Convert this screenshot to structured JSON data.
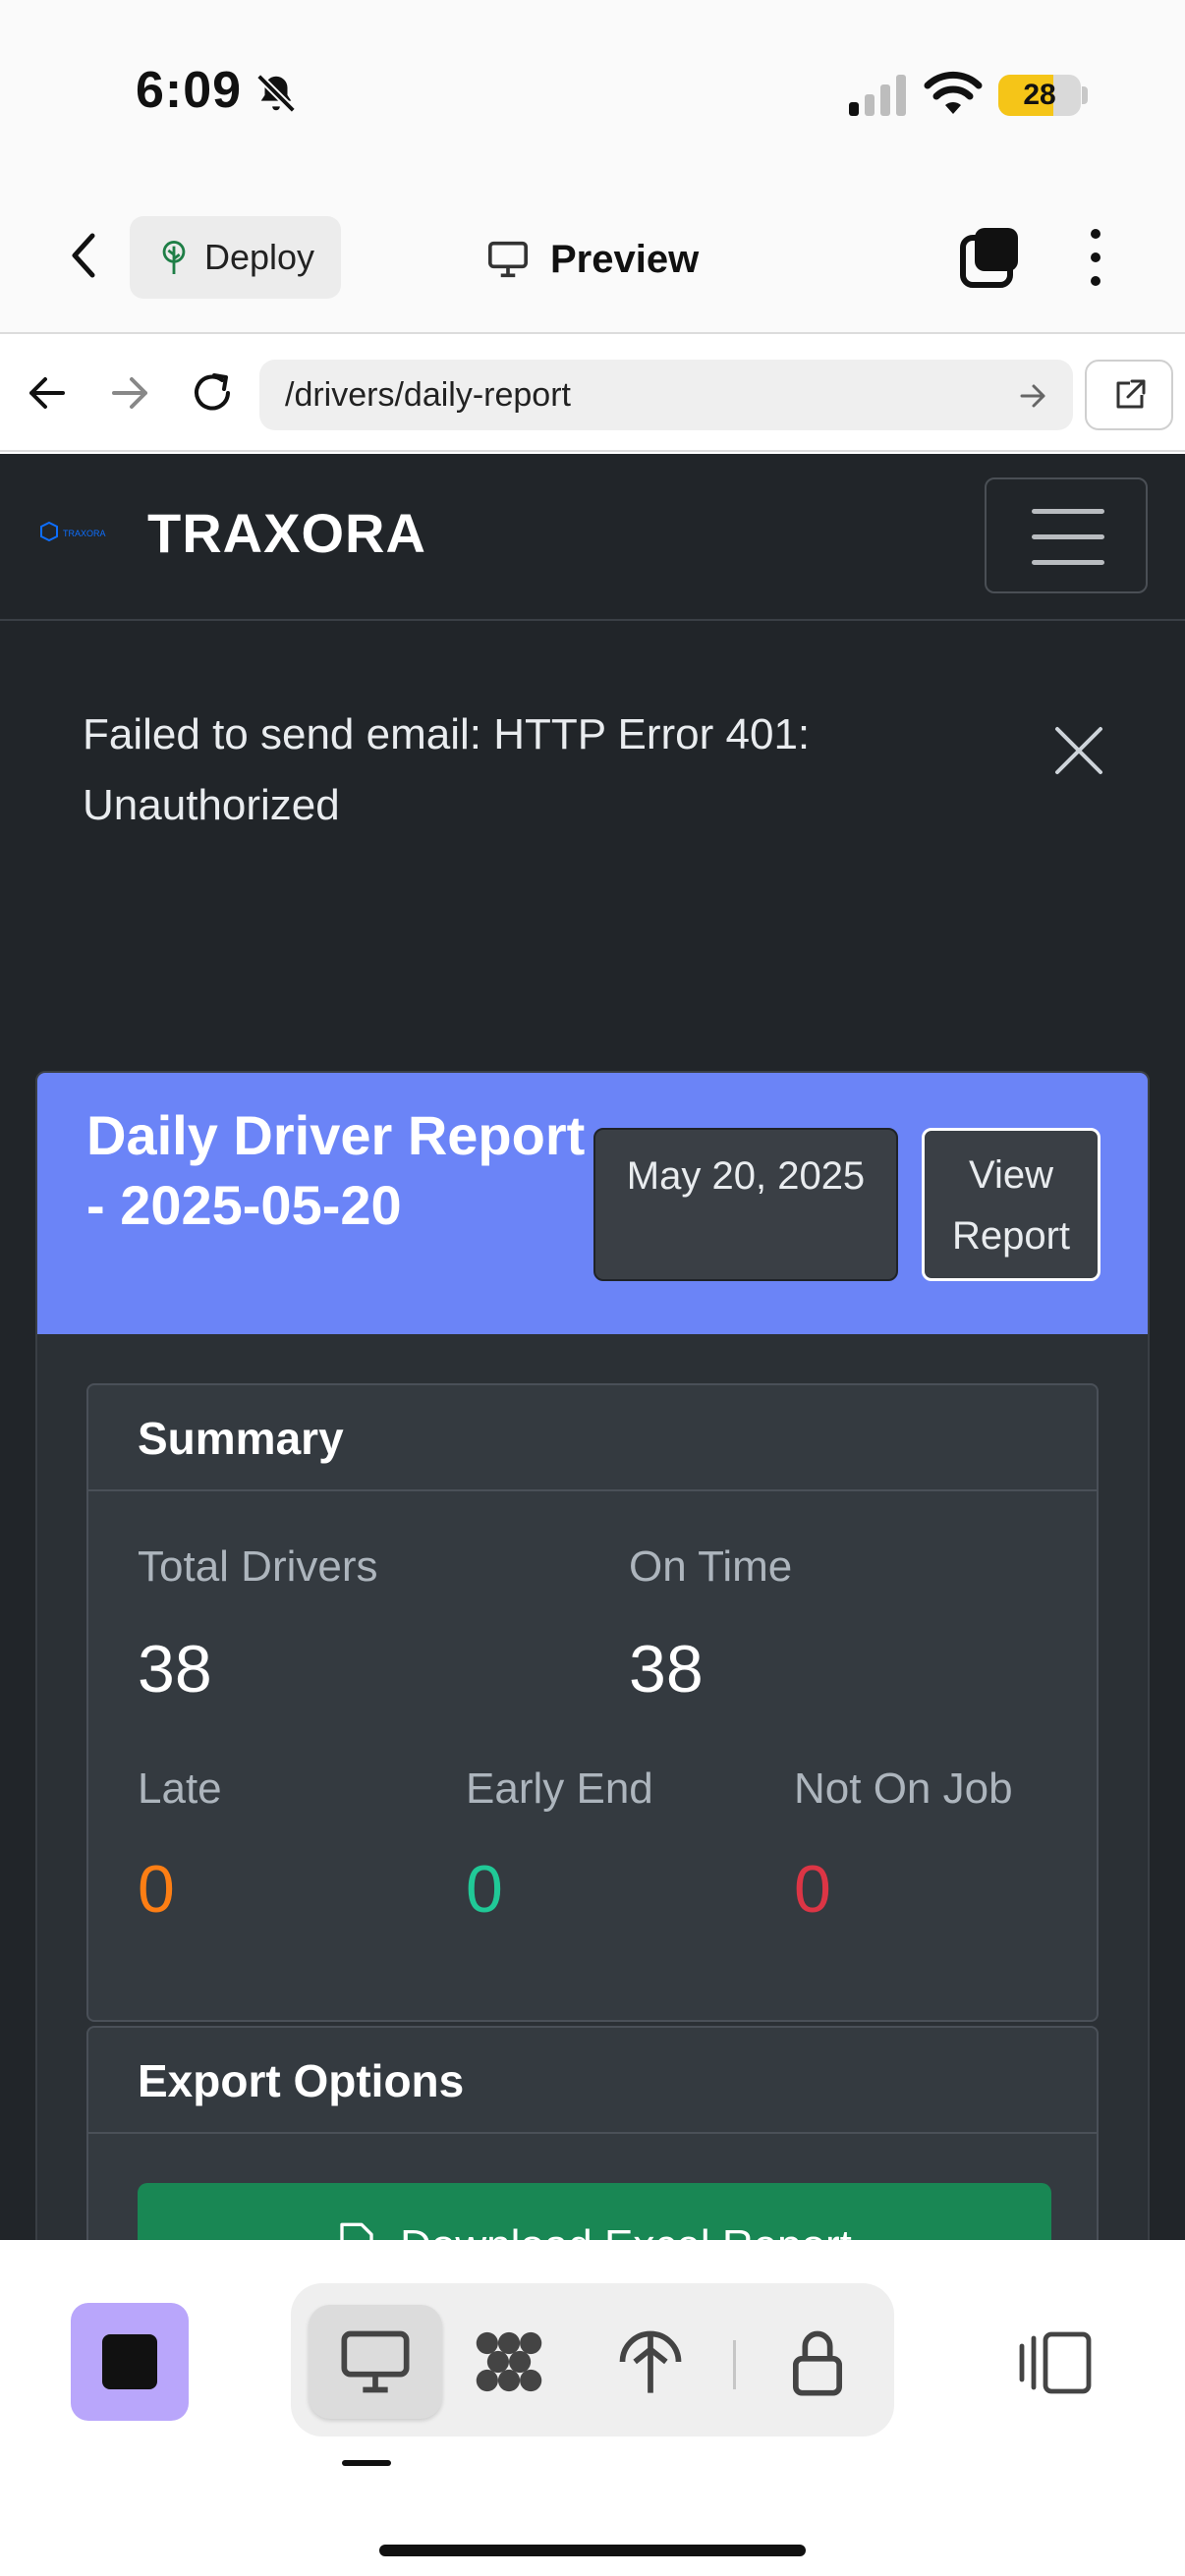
{
  "status_bar": {
    "time": "6:09",
    "battery": "28"
  },
  "app_header": {
    "deploy_label": "Deploy",
    "preview_label": "Preview"
  },
  "browser": {
    "url": "/drivers/daily-report"
  },
  "navbar": {
    "brand": "TRAXORA",
    "logo_text": "TRAXORA"
  },
  "alert": {
    "message": "Failed to send email: HTTP Error 401: Unauthorized"
  },
  "report": {
    "title": "Daily Driver Report - 2025-05-20",
    "date_button": "May 20, 2025",
    "view_button": "View Report",
    "summary": {
      "heading": "Summary",
      "total_drivers_label": "Total Drivers",
      "total_drivers_value": "38",
      "on_time_label": "On Time",
      "on_time_value": "38",
      "late_label": "Late",
      "late_value": "0",
      "early_end_label": "Early End",
      "early_end_value": "0",
      "not_on_job_label": "Not On Job",
      "not_on_job_value": "0"
    },
    "export": {
      "heading": "Export Options",
      "excel_button": "Download Excel Report"
    }
  },
  "colors": {
    "header_blue": "#6b84f7",
    "late": "#fd7e14",
    "early_end": "#20c997",
    "not_on_job": "#dc3545",
    "excel_green": "#198754",
    "stop_purple": "#b9a6fb"
  },
  "icons": {
    "status": [
      "bell-slash-icon",
      "cellular-signal-icon",
      "wifi-icon",
      "battery-icon"
    ],
    "header": [
      "back-chevron-icon",
      "deploy-tree-icon",
      "monitor-icon",
      "tabs-icon",
      "more-vertical-icon"
    ],
    "browser": [
      "arrow-left-icon",
      "arrow-right-icon",
      "reload-icon",
      "go-arrow-icon",
      "external-link-icon"
    ],
    "toolbar": [
      "stop-icon",
      "monitor-icon",
      "workflow-icon",
      "deploy-icon",
      "lock-icon",
      "panel-toggle-icon"
    ]
  }
}
